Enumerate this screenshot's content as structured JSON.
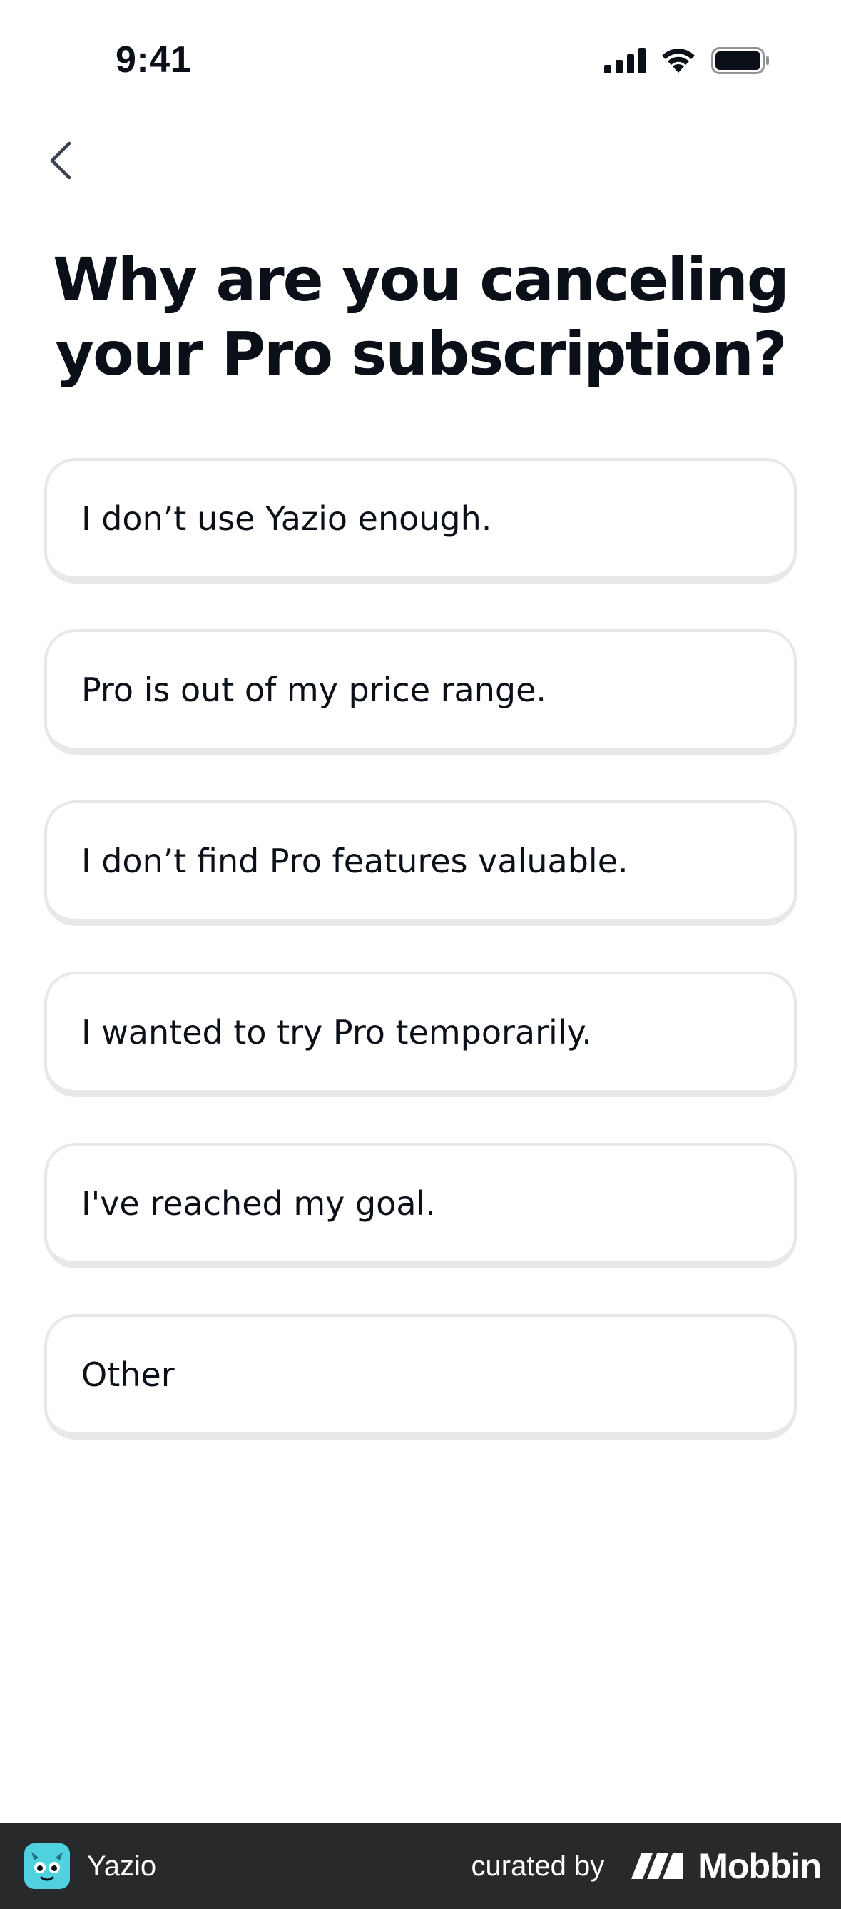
{
  "status_bar": {
    "time": "9:41",
    "icons": [
      "cellular-signal-icon",
      "wifi-icon",
      "battery-icon"
    ]
  },
  "nav": {
    "back_icon": "chevron-left-icon"
  },
  "header": {
    "title": "Why are you canceling your Pro subscription?"
  },
  "options": [
    {
      "label": "I don’t use Yazio enough."
    },
    {
      "label": "Pro is out of my price range."
    },
    {
      "label": "I don’t find Pro features valuable."
    },
    {
      "label": "I wanted to try Pro temporarily."
    },
    {
      "label": "I've reached my goal."
    },
    {
      "label": "Other"
    }
  ],
  "footer": {
    "app_name": "Yazio",
    "curated_by": "curated by",
    "brand": "Mobbin"
  },
  "colors": {
    "text": "#0b0f17",
    "option_border": "#e6e8ea",
    "footer_bg": "#27292b",
    "logo_teal": "#4fd1e0"
  }
}
